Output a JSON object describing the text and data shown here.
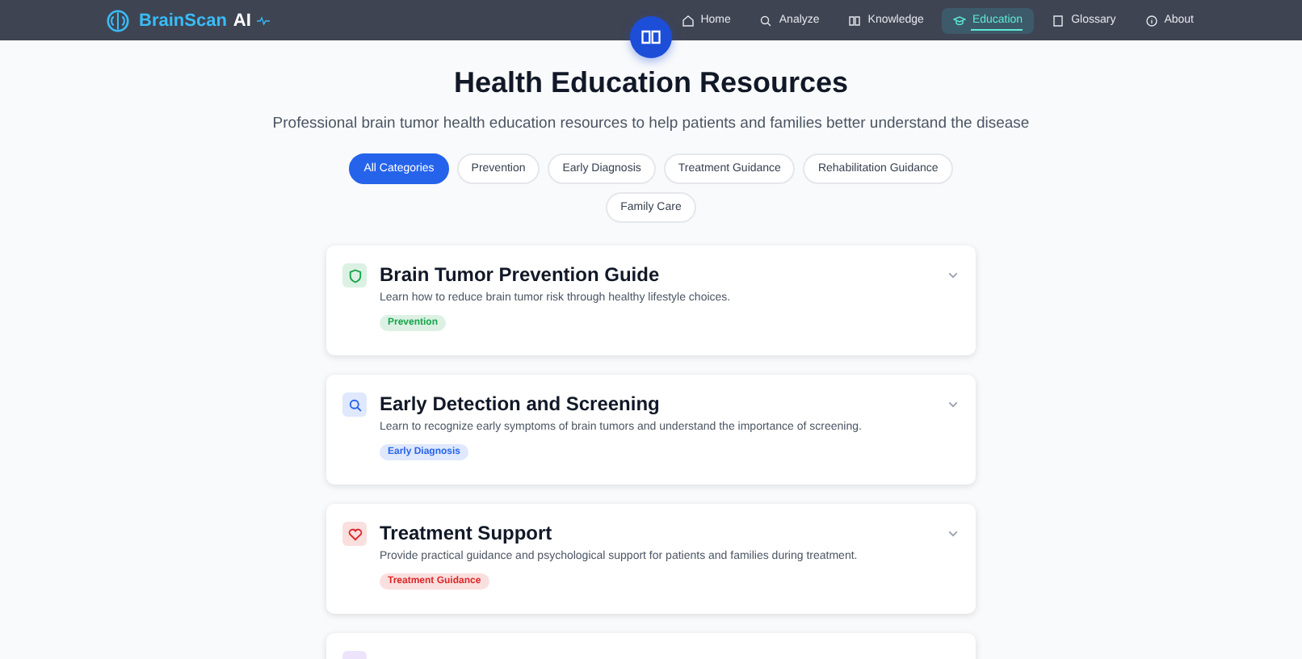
{
  "brand": {
    "name": "BrainScan",
    "suffix": "AI"
  },
  "nav": [
    {
      "label": "Home",
      "selected": false
    },
    {
      "label": "Analyze",
      "selected": false
    },
    {
      "label": "Knowledge",
      "selected": false
    },
    {
      "label": "Education",
      "selected": true
    },
    {
      "label": "Glossary",
      "selected": false
    },
    {
      "label": "About",
      "selected": false
    }
  ],
  "title": "Health Education Resources",
  "subtitle": "Professional brain tumor health education resources to help patients and families better understand the disease",
  "filters": [
    {
      "label": "All Categories",
      "selected": true
    },
    {
      "label": "Prevention",
      "selected": false
    },
    {
      "label": "Early Diagnosis",
      "selected": false
    },
    {
      "label": "Treatment Guidance",
      "selected": false
    },
    {
      "label": "Rehabilitation Guidance",
      "selected": false
    },
    {
      "label": "Family Care",
      "selected": false
    }
  ],
  "cards": [
    {
      "title": "Brain Tumor Prevention Guide",
      "description": "Learn how to reduce brain tumor risk through healthy lifestyle choices.",
      "tag": "Prevention",
      "color": "#16a34a"
    },
    {
      "title": "Early Detection and Screening",
      "description": "Learn to recognize early symptoms of brain tumors and understand the importance of screening.",
      "tag": "Early Diagnosis",
      "color": "#2563eb"
    },
    {
      "title": "Treatment Support",
      "description": "Provide practical guidance and psychological support for patients and families during treatment.",
      "tag": "Treatment Guidance",
      "color": "#dc2626"
    },
    {
      "color": "#ede4fb"
    }
  ]
}
